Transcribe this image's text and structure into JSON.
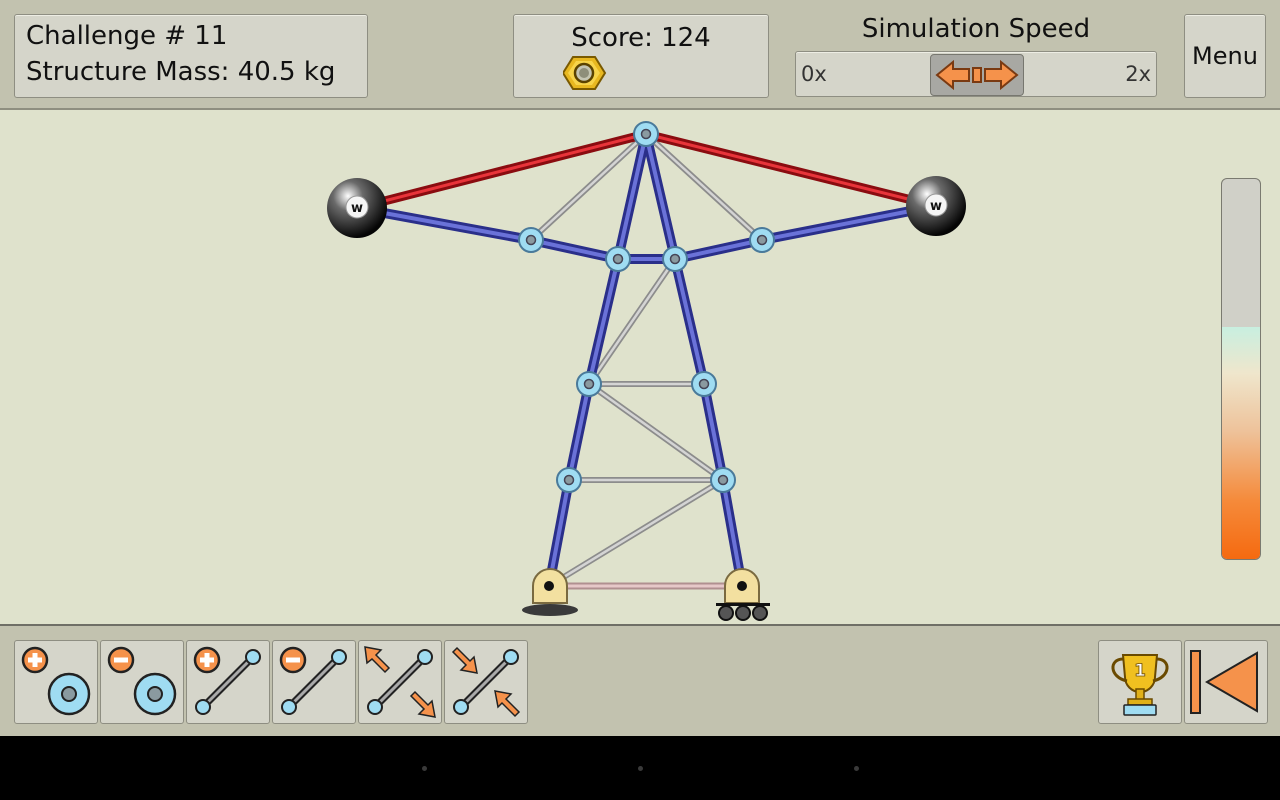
{
  "header": {
    "challenge_label": "Challenge # 11",
    "mass_label": "Structure Mass: 40.5 kg",
    "score_label": "Score: 124",
    "speed_title": "Simulation Speed",
    "speed_min": "0x",
    "speed_max": "2x",
    "menu_label": "Menu"
  },
  "weights": {
    "left_label": "w",
    "right_label": "w"
  },
  "stress_meter": {
    "level": 0.61
  },
  "toolbar": {
    "tools": [
      {
        "name": "add-joint"
      },
      {
        "name": "remove-joint"
      },
      {
        "name": "add-beam"
      },
      {
        "name": "remove-beam"
      },
      {
        "name": "lengthen-beam"
      },
      {
        "name": "shorten-beam"
      }
    ],
    "trophy_label": "1"
  },
  "colors": {
    "tension": "#c8161c",
    "compression": "#3a3fa8",
    "neutral": "#aaaaaa",
    "joint": "#9fdcf2",
    "accent": "#f5924b"
  }
}
